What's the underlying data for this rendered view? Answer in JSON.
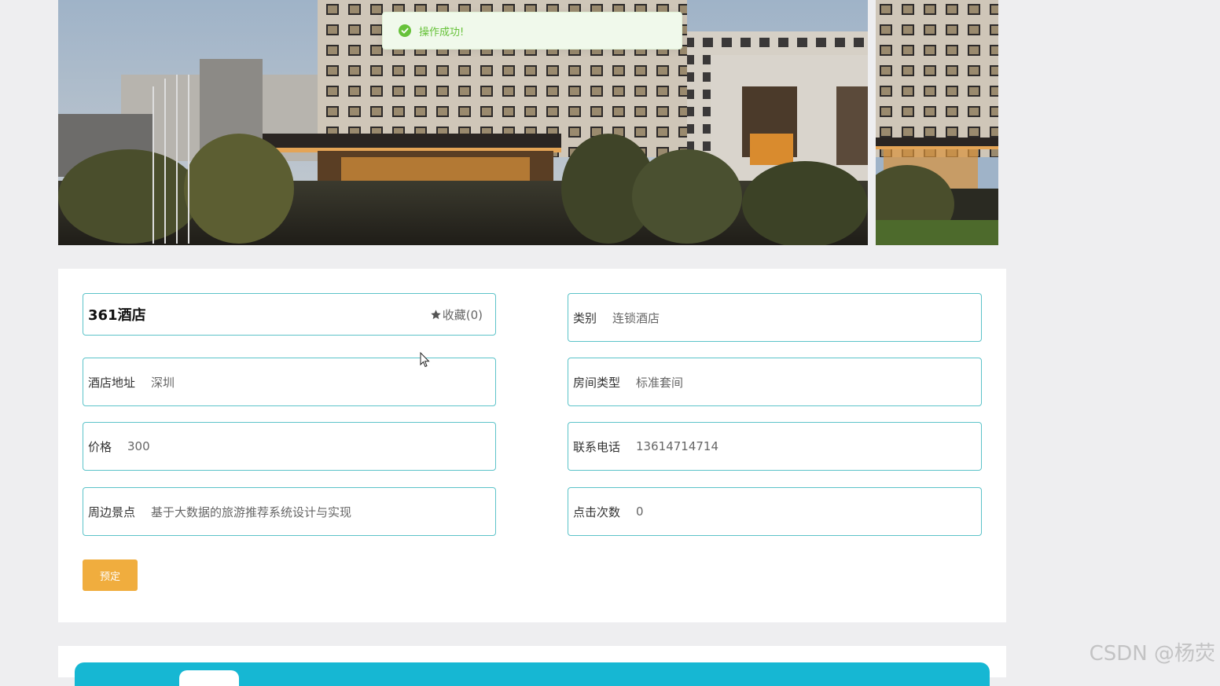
{
  "toast": {
    "message": "操作成功!",
    "icon": "success-check-icon",
    "color": "#67c23a"
  },
  "hotel": {
    "name": "361酒店",
    "favorite_label": "收藏(0)",
    "fields": {
      "category": {
        "label": "类别",
        "value": "连锁酒店"
      },
      "address": {
        "label": "酒店地址",
        "value": "深圳"
      },
      "room_type": {
        "label": "房间类型",
        "value": "标准套间"
      },
      "price": {
        "label": "价格",
        "value": "300"
      },
      "phone": {
        "label": "联系电话",
        "value": "13614714714"
      },
      "nearby": {
        "label": "周边景点",
        "value": "基于大数据的旅游推荐系统设计与实现"
      },
      "clicks": {
        "label": "点击次数",
        "value": "0"
      }
    },
    "book_label": "预定"
  },
  "watermark": "CSDN @杨荧",
  "colors": {
    "field_border": "#5cc3c9",
    "book_button": "#f0ad3e",
    "tab_bar": "#16b7d3"
  }
}
